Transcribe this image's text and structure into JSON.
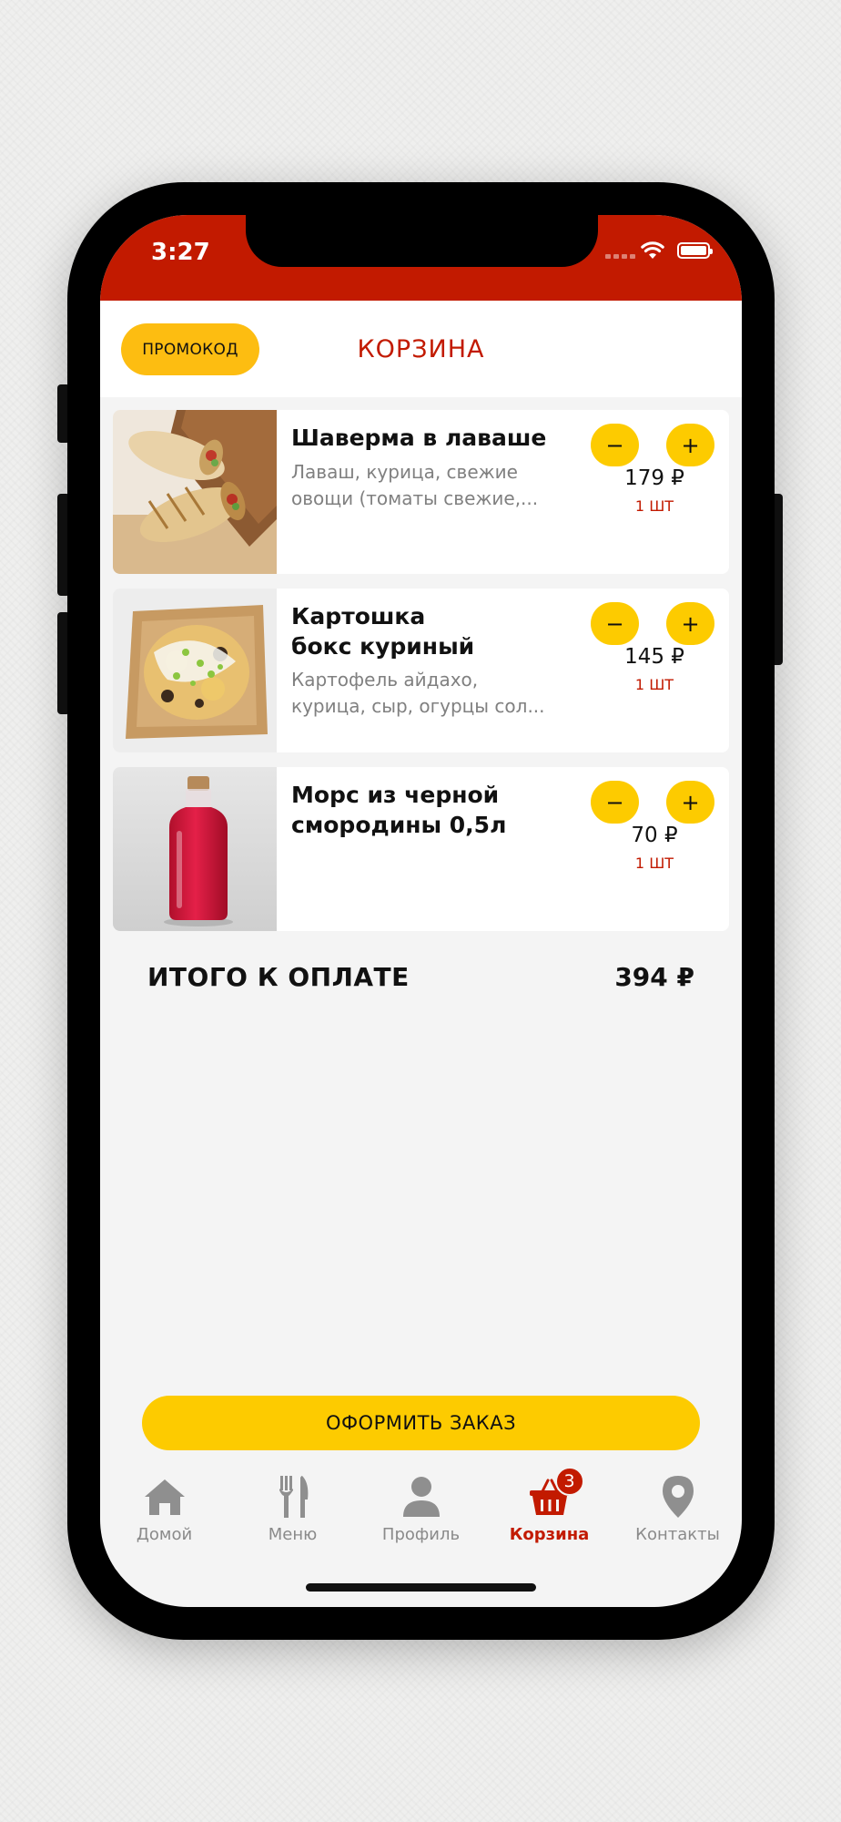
{
  "status_bar": {
    "time": "3:27"
  },
  "header": {
    "promo_label": "ПРОМОКОД",
    "title": "КОРЗИНА"
  },
  "cart": {
    "items": [
      {
        "name_lines": [
          "Шаверма в лаваше"
        ],
        "desc_lines": [
          "Лаваш, курица, свежие",
          "овощи (томаты свежие,..."
        ],
        "price": "179 ₽",
        "qty": "1 ШТ"
      },
      {
        "name_lines": [
          "Картошка",
          "бокс куриный"
        ],
        "desc_lines": [
          "Картофель айдахо,",
          "курица, сыр, огурцы сол..."
        ],
        "price": "145 ₽",
        "qty": "1 ШТ"
      },
      {
        "name_lines": [
          "Морс из черной",
          "смородины 0,5л"
        ],
        "desc_lines": [],
        "price": "70 ₽",
        "qty": "1 ШТ"
      }
    ],
    "minus_symbol": "−",
    "plus_symbol": "+"
  },
  "total": {
    "label": "ИТОГО К ОПЛАТЕ",
    "value": "394 ₽"
  },
  "checkout": {
    "label": "ОФОРМИТЬ ЗАКАЗ"
  },
  "tabbar": {
    "tabs": [
      {
        "label": "Домой",
        "icon": "home-icon"
      },
      {
        "label": "Меню",
        "icon": "fork-knife-icon"
      },
      {
        "label": "Профиль",
        "icon": "user-icon"
      },
      {
        "label": "Корзина",
        "icon": "basket-icon",
        "badge": "3",
        "active": true
      },
      {
        "label": "Контакты",
        "icon": "location-pin-icon"
      }
    ]
  },
  "colors": {
    "brand_red": "#c21a00",
    "accent_yellow": "#fdcb00",
    "promo_yellow": "#fdbd11",
    "inactive_gray": "#8a8a8a"
  }
}
